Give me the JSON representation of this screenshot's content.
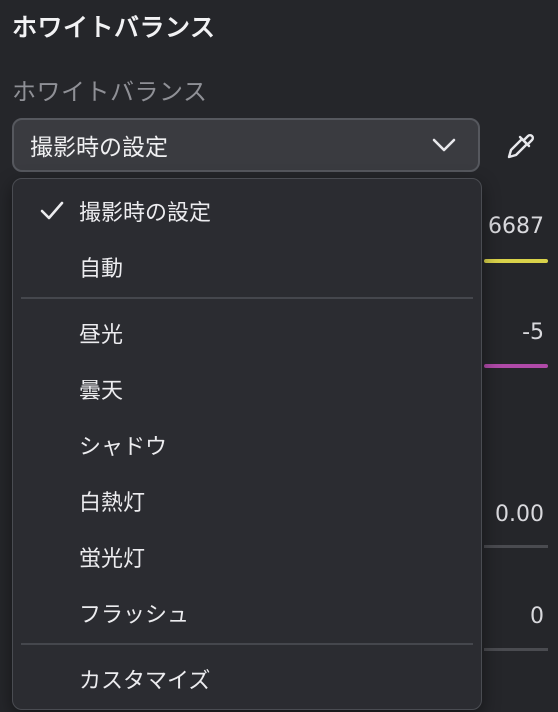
{
  "panel": {
    "title": "ホワイトバランス",
    "wb_label": "ホワイトバランス",
    "selected_value": "撮影時の設定"
  },
  "menu": {
    "groups": [
      [
        {
          "label": "撮影時の設定",
          "checked": true
        },
        {
          "label": "自動",
          "checked": false
        }
      ],
      [
        {
          "label": "昼光",
          "checked": false
        },
        {
          "label": "曇天",
          "checked": false
        },
        {
          "label": "シャドウ",
          "checked": false
        },
        {
          "label": "白熱灯",
          "checked": false
        },
        {
          "label": "蛍光灯",
          "checked": false
        },
        {
          "label": "フラッシュ",
          "checked": false
        }
      ],
      [
        {
          "label": "カスタマイズ",
          "checked": false
        }
      ]
    ]
  },
  "background": {
    "temperature_value": "6687",
    "tint_value": "-5",
    "value_3": "0.00",
    "value_4": "0",
    "temperature_color": "#d9d24a",
    "tint_color": "#b04aa8"
  },
  "icons": {
    "chevron": "chevron-down-icon",
    "eyedropper": "eyedropper-icon",
    "check": "check-icon"
  }
}
